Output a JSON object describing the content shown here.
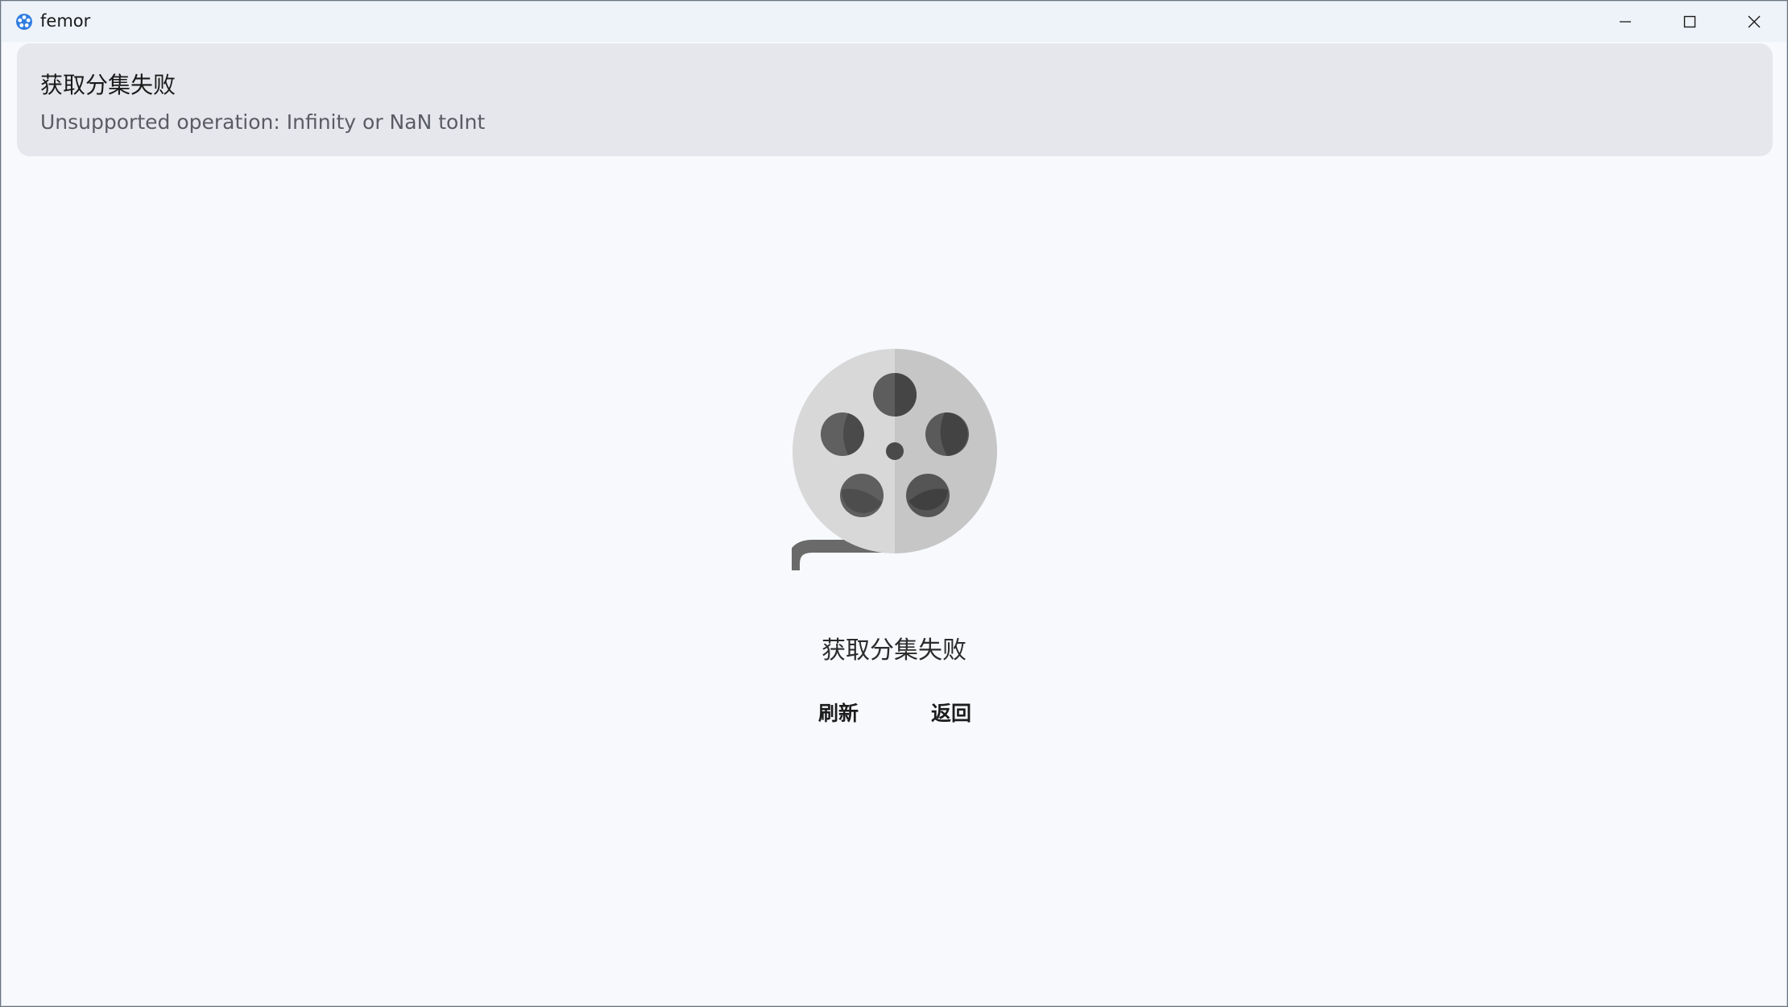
{
  "window": {
    "title": "femor",
    "controls": {
      "minimize": "minimize-icon",
      "maximize": "maximize-icon",
      "close": "close-icon"
    }
  },
  "banner": {
    "title": "获取分集失败",
    "message": "Unsupported operation: Infinity or NaN toInt"
  },
  "main": {
    "illustration": "film-reel-icon",
    "error_text": "获取分集失败",
    "refresh_label": "刷新",
    "back_label": "返回"
  },
  "colors": {
    "background": "#f7f9fd",
    "banner_bg": "#e6e7ec",
    "app_icon_accent": "#2f7de1"
  }
}
